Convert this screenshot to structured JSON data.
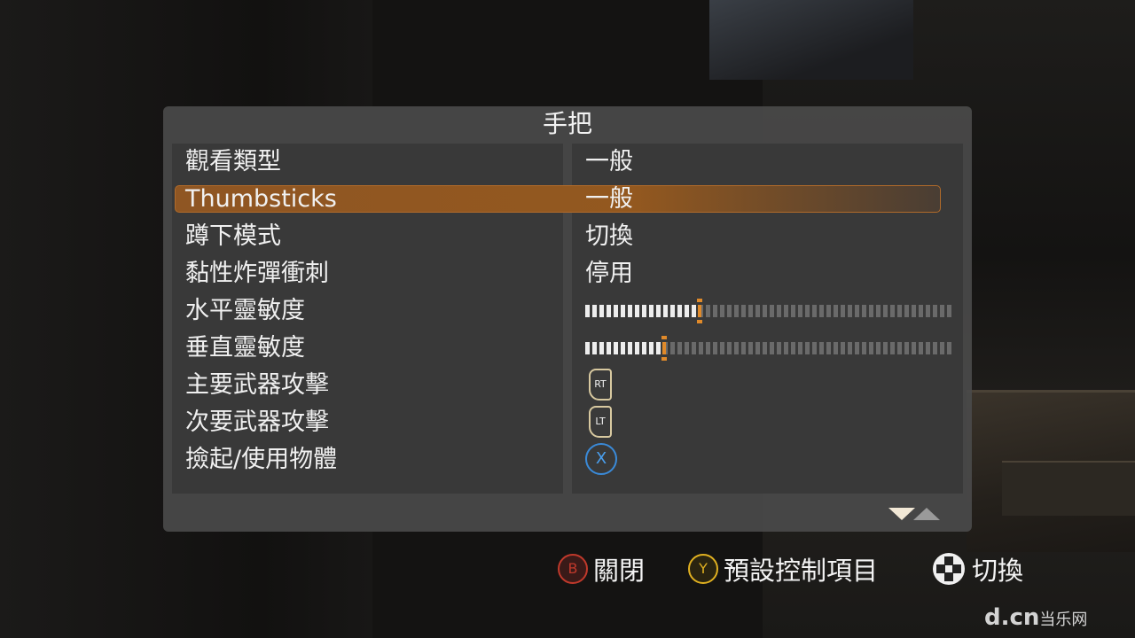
{
  "panel": {
    "title": "手把"
  },
  "settings": [
    {
      "label": "觀看類型",
      "value": "一般"
    },
    {
      "label": "Thumbsticks",
      "value": "一般"
    },
    {
      "label": "蹲下模式",
      "value": "切換"
    },
    {
      "label": "黏性炸彈衝刺",
      "value": "停用"
    },
    {
      "label": "水平靈敏度",
      "level": 0.3
    },
    {
      "label": "垂直靈敏度",
      "level": 0.22
    },
    {
      "label": "主要武器攻擊",
      "button_icon": "rt-trigger-icon",
      "button_text": "RT"
    },
    {
      "label": "次要武器攻擊",
      "button_icon": "lt-trigger-icon",
      "button_text": "LT"
    },
    {
      "label": "撿起/使用物體",
      "button_icon": "x-button-icon",
      "button_text": "X"
    }
  ],
  "legend": {
    "close": {
      "key": "B",
      "label": "關閉",
      "color": "#c0392b"
    },
    "defaults": {
      "key": "Y",
      "label": "預設控制項目",
      "color": "#e0b020"
    },
    "toggle": {
      "label": "切換"
    }
  },
  "watermark": {
    "text": "d.cn",
    "sub": "当乐网"
  },
  "colors": {
    "highlight": "#93581f",
    "slider_marker": "#e08a2a"
  }
}
